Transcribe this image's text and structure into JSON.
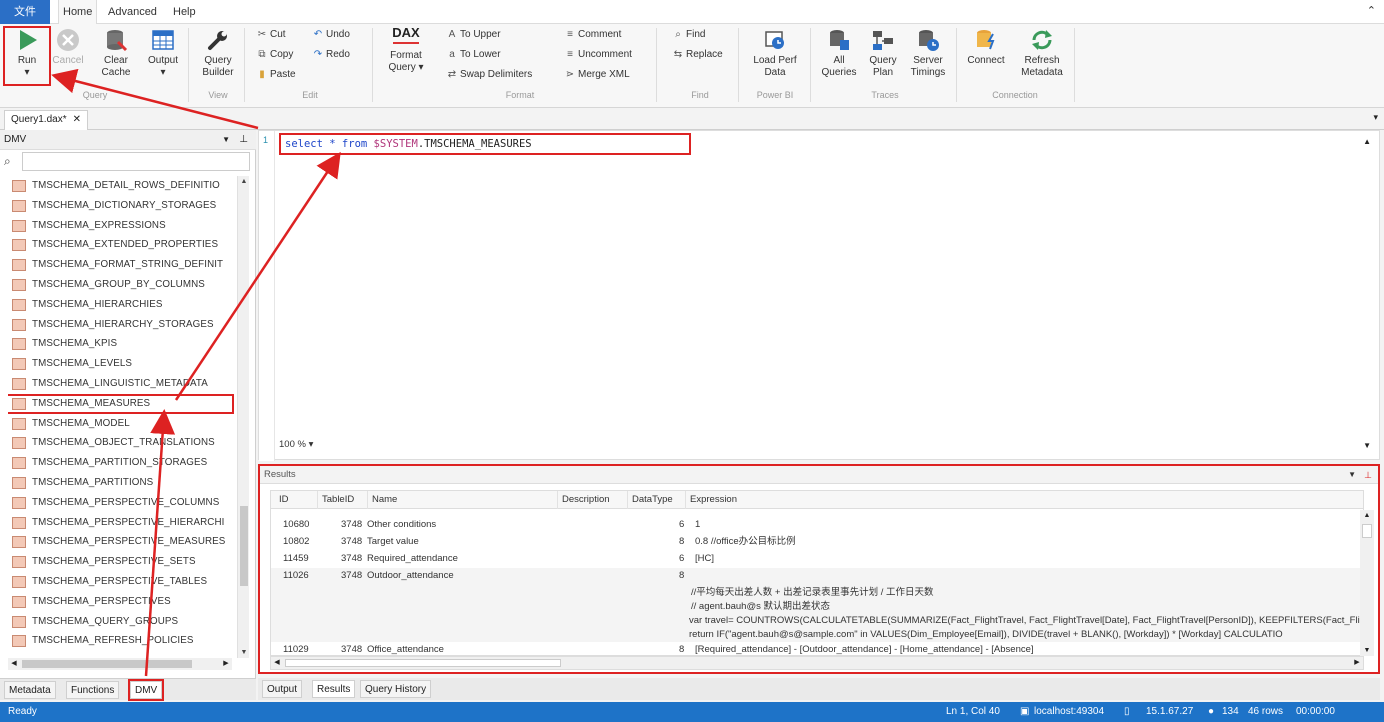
{
  "menu": {
    "file": "文件",
    "tabs": [
      "Home",
      "Advanced",
      "Help"
    ]
  },
  "ribbon": {
    "query": {
      "run": "Run",
      "cancel": "Cancel",
      "clear_cache": [
        "Clear",
        "Cache"
      ],
      "output": "Output",
      "group": "Query"
    },
    "view": {
      "query_builder": [
        "Query",
        "Builder"
      ],
      "group": "View"
    },
    "edit": {
      "cut": "Cut",
      "copy": "Copy",
      "paste": "Paste",
      "undo": "Undo",
      "redo": "Redo",
      "group": "Edit"
    },
    "format": {
      "dax": "DAX",
      "format_query": [
        "Format",
        "Query"
      ],
      "to_upper": "To Upper",
      "to_lower": "To Lower",
      "swap_delimiters": "Swap Delimiters",
      "comment": "Comment",
      "uncomment": "Uncomment",
      "merge_xml": "Merge XML",
      "group": "Format"
    },
    "find": {
      "find": "Find",
      "replace": "Replace",
      "group": "Find"
    },
    "power_bi": {
      "load_perf": [
        "Load Perf",
        "Data"
      ],
      "group": "Power BI"
    },
    "traces": {
      "all_queries": [
        "All",
        "Queries"
      ],
      "query_plan": [
        "Query",
        "Plan"
      ],
      "server_timings": [
        "Server",
        "Timings"
      ],
      "group": "Traces"
    },
    "connection": {
      "connect": "Connect",
      "refresh_metadata": [
        "Refresh",
        "Metadata"
      ],
      "group": "Connection"
    }
  },
  "document_tab": {
    "title": "Query1.dax*",
    "close": "✕"
  },
  "left_panel": {
    "title": "DMV",
    "items": [
      "TMSCHEMA_DETAIL_ROWS_DEFINITIO",
      "TMSCHEMA_DICTIONARY_STORAGES",
      "TMSCHEMA_EXPRESSIONS",
      "TMSCHEMA_EXTENDED_PROPERTIES",
      "TMSCHEMA_FORMAT_STRING_DEFINIT",
      "TMSCHEMA_GROUP_BY_COLUMNS",
      "TMSCHEMA_HIERARCHIES",
      "TMSCHEMA_HIERARCHY_STORAGES",
      "TMSCHEMA_KPIS",
      "TMSCHEMA_LEVELS",
      "TMSCHEMA_LINGUISTIC_METADATA",
      "TMSCHEMA_MEASURES",
      "TMSCHEMA_MODEL",
      "TMSCHEMA_OBJECT_TRANSLATIONS",
      "TMSCHEMA_PARTITION_STORAGES",
      "TMSCHEMA_PARTITIONS",
      "TMSCHEMA_PERSPECTIVE_COLUMNS",
      "TMSCHEMA_PERSPECTIVE_HIERARCHI",
      "TMSCHEMA_PERSPECTIVE_MEASURES",
      "TMSCHEMA_PERSPECTIVE_SETS",
      "TMSCHEMA_PERSPECTIVE_TABLES",
      "TMSCHEMA_PERSPECTIVES",
      "TMSCHEMA_QUERY_GROUPS",
      "TMSCHEMA_REFRESH_POLICIES"
    ],
    "tabs": [
      "Metadata",
      "Functions",
      "DMV"
    ]
  },
  "editor": {
    "line_number": "1",
    "query": {
      "kw1": "select",
      "star": "*",
      "kw2": "from",
      "schema": "$SYSTEM",
      "table": ".TMSCHEMA_MEASURES"
    },
    "zoom": "100 % ▾"
  },
  "results": {
    "title": "Results",
    "columns": [
      "ID",
      "TableID",
      "Name",
      "Description",
      "DataType",
      "Expression"
    ],
    "rows": [
      {
        "id": "10680",
        "table_id": "3748",
        "name": "Other conditions",
        "data_type": "6",
        "expr": "1"
      },
      {
        "id": "10802",
        "table_id": "3748",
        "name": "Target value",
        "data_type": "8",
        "expr": "0.8  //office办公目标比例"
      },
      {
        "id": "11459",
        "table_id": "3748",
        "name": "Required_attendance",
        "data_type": "6",
        "expr": "[HC]"
      },
      {
        "id": "11026",
        "table_id": "3748",
        "name": "Outdoor_attendance",
        "data_type": "8",
        "expr": ""
      },
      {
        "id": "11029",
        "table_id": "3748",
        "name": "Office_attendance",
        "data_type": "8",
        "expr": "[Required_attendance] - [Outdoor_attendance] - [Home_attendance] - [Absence]"
      }
    ],
    "continuation": [
      "//平均每天出差人数 + 出差记录表里事先计划 / 工作日天数",
      "// agent.bauh@s 默认期出差状态",
      "var travel= COUNTROWS(CALCULATETABLE(SUMMARIZE(Fact_FlightTravel, Fact_FlightTravel[Date], Fact_FlightTravel[PersonID]), KEEPFILTERS(Fact_Fli",
      "return IF(\"agent.bauh@s@sample.com\" in VALUES(Dim_Employee[Email]), DIVIDE(travel + BLANK(), [Workday])  * [Workday] CALCULATIO"
    ]
  },
  "bottom_tabs": [
    "Output",
    "Results",
    "Query History"
  ],
  "status": {
    "ready": "Ready",
    "position": "Ln 1, Col 40",
    "server": "localhost:49304",
    "version": "15.1.67.27",
    "spid": "134",
    "rows": "46 rows",
    "time": "00:00:00"
  },
  "colors": {
    "accent": "#1e73c8",
    "annotation": "#dd2222",
    "table_icon": "#f3c9b7"
  }
}
